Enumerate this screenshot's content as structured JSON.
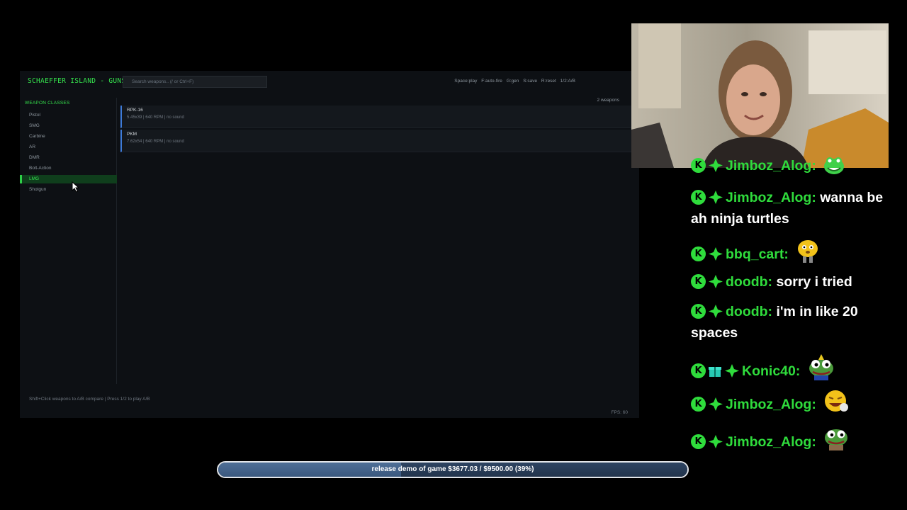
{
  "app": {
    "title": "SCHAEFFER ISLAND - GUNS",
    "search_placeholder": "Search weapons.. (/ or Ctrl+F)",
    "controls": [
      "Space:play",
      "F:auto-fire",
      "G:gen",
      "S:save",
      "R:reset",
      "1/2:A/B"
    ],
    "sidebar_title": "WEAPON CLASSES",
    "classes": [
      "Pistol",
      "SMG",
      "Carbine",
      "AR",
      "DMR",
      "Bolt-Action",
      "LMG",
      "Shotgun"
    ],
    "active_class": "LMG",
    "weapon_count": "2 weapons",
    "weapons": [
      {
        "name": "RPK-16",
        "info": "5.45x39  |  640 RPM  |  no sound"
      },
      {
        "name": "PKM",
        "info": "7.62x54  |  640 RPM  |  no sound"
      }
    ],
    "hint": "Shift+Click weapons to A/B compare  |  Press 1/2 to play A/B",
    "fps": "FPS: 60"
  },
  "chat": [
    {
      "user": "Jimboz_Alog:",
      "text": "",
      "emote": "frog-emote",
      "gift": false
    },
    {
      "user": "Jimboz_Alog:",
      "text": "wanna be ah ninja turtles",
      "emote": "",
      "gift": false
    },
    {
      "user": "bbq_cart:",
      "text": "",
      "emote": "mushroom-emote",
      "gift": false
    },
    {
      "user": "doodb:",
      "text": "sorry i tried",
      "emote": "",
      "gift": false
    },
    {
      "user": "doodb:",
      "text": "i'm in like 20 spaces",
      "emote": "",
      "gift": false
    },
    {
      "user": "Konic40:",
      "text": "",
      "emote": "pepe-emote",
      "gift": true
    },
    {
      "user": "Jimboz_Alog:",
      "text": "",
      "emote": "laughing-emote",
      "gift": false
    },
    {
      "user": "Jimboz_Alog:",
      "text": "",
      "emote": "pepe-emote",
      "gift": false
    }
  ],
  "goal": {
    "label": "release demo of game $3677.03 / $9500.00 (39%)",
    "progress": 0.39
  },
  "colors": {
    "accent_green": "#35e04c",
    "chat_green": "#2fdc3c",
    "weapon_border": "#3e7bd8",
    "progress_fill": "#4f6f97"
  }
}
